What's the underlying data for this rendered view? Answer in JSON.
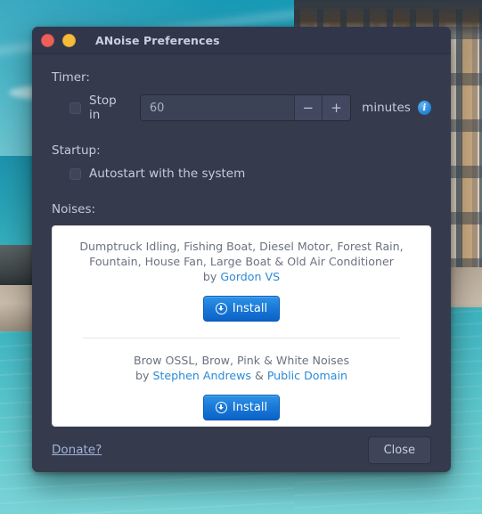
{
  "window": {
    "title": "ANoise Preferences",
    "controls": {
      "close": "close-button",
      "minimize": "minimize-button"
    }
  },
  "timer": {
    "heading": "Timer:",
    "checkbox_label": "Stop in",
    "checkbox_checked": false,
    "value": "60",
    "placeholder": "60",
    "decrement_label": "−",
    "increment_label": "+",
    "units_label": "minutes",
    "info_label": "i"
  },
  "startup": {
    "heading": "Startup:",
    "checkbox_label": "Autostart with the system",
    "checkbox_checked": false
  },
  "noises": {
    "heading": "Noises:",
    "packs": [
      {
        "titles": "Dumptruck Idling, Fishing Boat, Diesel Motor, Forest Rain, Fountain, House Fan, Large Boat & Old Air Conditioner",
        "by_prefix": "by ",
        "authors": "Gordon VS",
        "install_label": "Install"
      },
      {
        "titles": "Brow OSSL, Brow, Pink & White Noises",
        "by_prefix": "by ",
        "author_one": "Stephen Andrews",
        "author_sep": " & ",
        "author_two": "Public Domain",
        "install_label": "Install"
      }
    ]
  },
  "footer": {
    "donate_label": "Donate?",
    "close_label": "Close"
  },
  "colors": {
    "window_bg": "#353a4c",
    "titlebar_bg": "#31364a",
    "accent_blue": "#2b8ad8",
    "install_blue": "#1b7ad8",
    "close_dot": "#ed5f5b",
    "minimize_dot": "#f5bc3c",
    "card_bg": "#ffffff"
  }
}
